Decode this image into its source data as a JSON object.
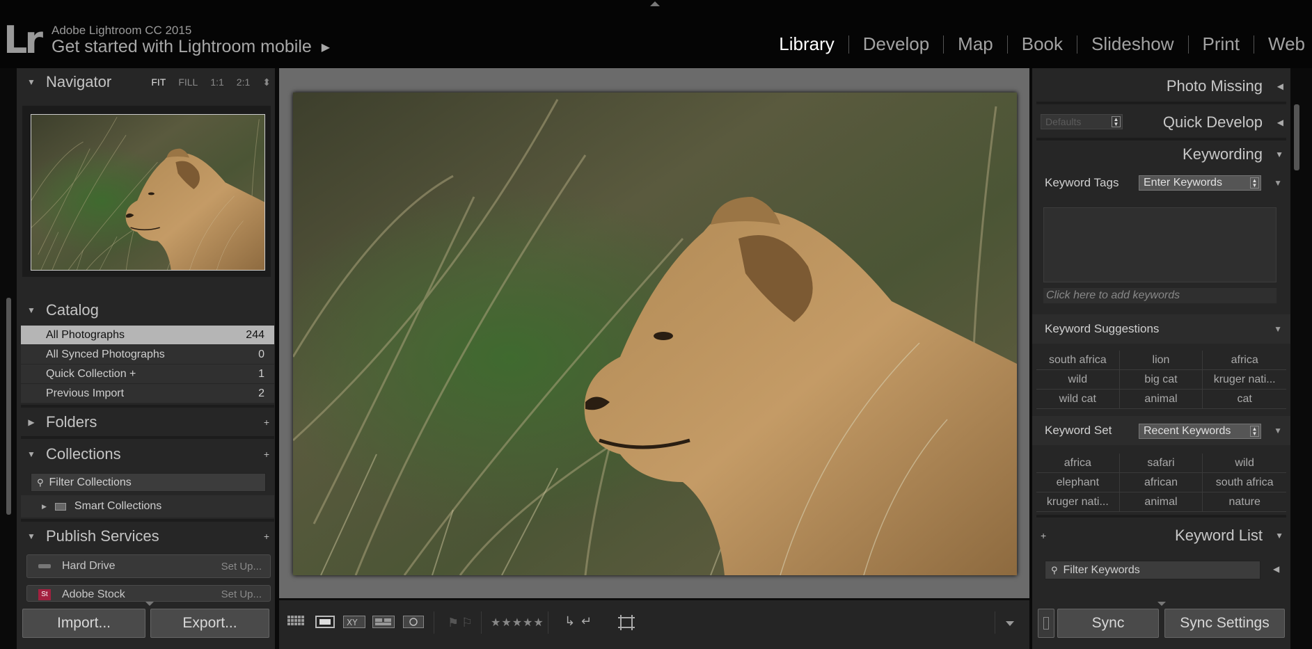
{
  "app": {
    "version": "Adobe Lightroom CC 2015",
    "mobile_prompt": "Get started with Lightroom mobile",
    "logo_text": "Lr"
  },
  "modules": [
    "Library",
    "Develop",
    "Map",
    "Book",
    "Slideshow",
    "Print",
    "Web"
  ],
  "active_module": "Library",
  "navigator": {
    "title": "Navigator",
    "zoom_options": [
      "FIT",
      "FILL",
      "1:1",
      "2:1"
    ],
    "active_zoom": "FIT"
  },
  "catalog": {
    "title": "Catalog",
    "items": [
      {
        "label": "All Photographs",
        "count": "244"
      },
      {
        "label": "All Synced Photographs",
        "count": "0"
      },
      {
        "label": "Quick Collection  +",
        "count": "1"
      },
      {
        "label": "Previous Import",
        "count": "2"
      }
    ]
  },
  "folders": {
    "title": "Folders"
  },
  "collections": {
    "title": "Collections",
    "filter_label": "Filter Collections",
    "smart_collections": "Smart Collections"
  },
  "publish": {
    "title": "Publish Services",
    "services": [
      {
        "label": "Hard Drive",
        "action": "Set Up..."
      },
      {
        "label": "Adobe Stock",
        "action": "Set Up..."
      }
    ]
  },
  "left_buttons": {
    "import": "Import...",
    "export": "Export..."
  },
  "right": {
    "photo_missing": "Photo Missing",
    "quick_develop": "Quick Develop",
    "qd_preset": "Defaults",
    "keywording": "Keywording",
    "keyword_tags_label": "Keyword Tags",
    "keyword_tags_mode": "Enter Keywords",
    "add_keywords_placeholder": "Click here to add keywords",
    "suggestions_label": "Keyword Suggestions",
    "suggestions": [
      "south africa",
      "lion",
      "africa",
      "wild",
      "big cat",
      "kruger nati...",
      "wild cat",
      "animal",
      "cat"
    ],
    "keyword_set_label": "Keyword Set",
    "keyword_set_value": "Recent Keywords",
    "keyword_set": [
      "africa",
      "safari",
      "wild",
      "elephant",
      "african",
      "south africa",
      "kruger nati...",
      "animal",
      "nature"
    ],
    "keyword_list": "Keyword List",
    "filter_keywords": "Filter Keywords"
  },
  "right_buttons": {
    "sync": "Sync",
    "sync_settings": "Sync Settings"
  },
  "colors": {
    "panel": "#262626",
    "center_bg": "#6b6b6b",
    "selected_row": "#b5b5b5",
    "active_text": "#ffffff"
  }
}
